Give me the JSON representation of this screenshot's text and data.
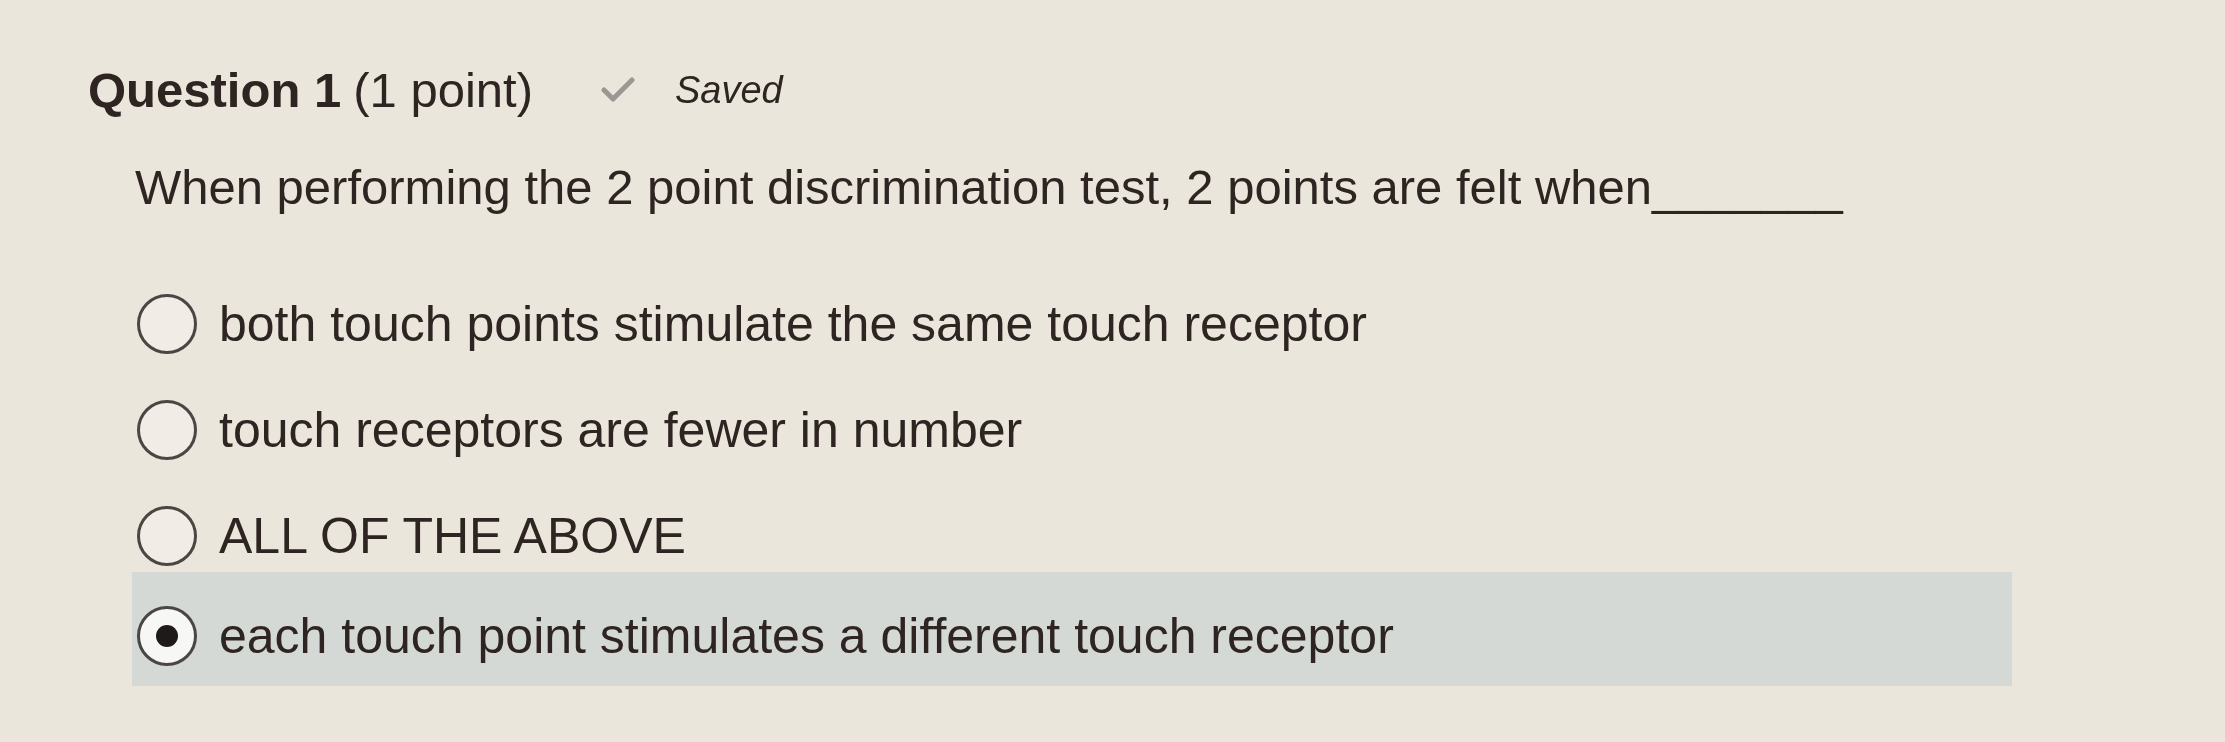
{
  "question": {
    "title": "Question 1",
    "points": "(1 point)",
    "status": "Saved",
    "text": "When performing the 2 point discrimination test, 2 points are felt when_______"
  },
  "options": [
    {
      "label": "both touch points stimulate the same touch receptor",
      "selected": false
    },
    {
      "label": "touch receptors are fewer in number",
      "selected": false
    },
    {
      "label": "ALL OF THE ABOVE",
      "selected": false
    },
    {
      "label": "each touch point stimulates a different touch receptor",
      "selected": true
    }
  ]
}
